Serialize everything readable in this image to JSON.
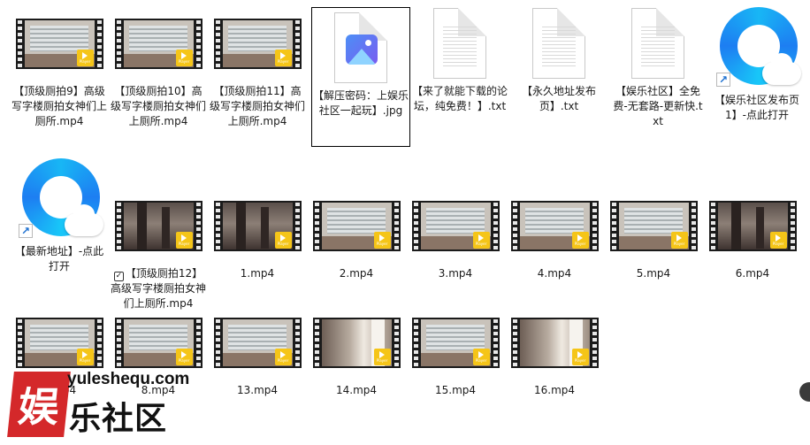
{
  "files": [
    {
      "name": "【顶级厕拍9】高级写字楼厕拍女神们上厕所.mp4",
      "type": "video",
      "scene": "blinds"
    },
    {
      "name": "【顶级厕拍10】高级写字楼厕拍女神们上厕所.mp4",
      "type": "video",
      "scene": "blinds"
    },
    {
      "name": "【顶级厕拍11】高级写字楼厕拍女神们上厕所.mp4",
      "type": "video",
      "scene": "blinds"
    },
    {
      "name": "【解压密码：上娱乐社区一起玩】.jpg",
      "type": "image",
      "selected": true
    },
    {
      "name": "【来了就能下载的论坛，纯免费！】.txt",
      "type": "text"
    },
    {
      "name": "【永久地址发布页】.txt",
      "type": "text"
    },
    {
      "name": "【娱乐社区】全免费-无套路-更新快.txt",
      "type": "text"
    },
    {
      "name": "【娱乐社区发布页1】-点此打开",
      "type": "shortcut"
    },
    {
      "name": "【最新地址】-点此打开",
      "type": "shortcut"
    },
    {
      "name": "【顶级厕拍12】高级写字楼厕拍女神们上厕所.mp4",
      "type": "video",
      "scene": "dark",
      "checkbox": true
    },
    {
      "name": "1.mp4",
      "type": "video",
      "scene": "dark"
    },
    {
      "name": "2.mp4",
      "type": "video",
      "scene": "blinds"
    },
    {
      "name": "3.mp4",
      "type": "video",
      "scene": "blinds"
    },
    {
      "name": "4.mp4",
      "type": "video",
      "scene": "blinds"
    },
    {
      "name": "5.mp4",
      "type": "video",
      "scene": "blinds"
    },
    {
      "name": "6.mp4",
      "type": "video",
      "scene": "dark"
    },
    {
      "name": "7.mp4",
      "type": "video",
      "scene": "blinds"
    },
    {
      "name": "8.mp4",
      "type": "video",
      "scene": "blinds"
    },
    {
      "name": "13.mp4",
      "type": "video",
      "scene": "blinds"
    },
    {
      "name": "14.mp4",
      "type": "video",
      "scene": "room"
    },
    {
      "name": "15.mp4",
      "type": "video",
      "scene": "blinds"
    },
    {
      "name": "16.mp4",
      "type": "video",
      "scene": "room"
    }
  ],
  "player_badge": "Player",
  "checkbox_mark": "✓",
  "shortcut_arrow": "↗",
  "watermark": {
    "logo_char": "娱",
    "domain": "yulesheq u.com",
    "name": "乐社区"
  },
  "colors": {
    "brand_red": "#d4282a",
    "badge_yellow": "#f5c518",
    "browser_blue": "#1d7ef2"
  },
  "icons": {
    "video": "video-file-icon",
    "image": "image-file-icon",
    "text": "text-file-icon",
    "shortcut": "browser-shortcut-icon"
  }
}
